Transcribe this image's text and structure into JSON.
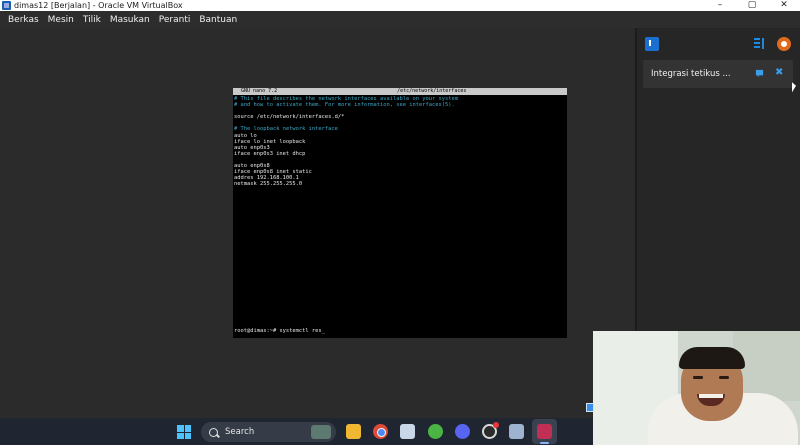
{
  "window": {
    "title": "dimas12 [Berjalan] - Oracle VM VirtualBox",
    "controls": [
      "–",
      "▢",
      "✕"
    ]
  },
  "menu": {
    "items": [
      "Berkas",
      "Mesin",
      "Tilik",
      "Masukan",
      "Peranti",
      "Bantuan"
    ]
  },
  "terminal": {
    "editor": "GNU nano 7.2",
    "file": "/etc/network/interfaces",
    "lines": [
      {
        "text": "# This file describes the network interfaces available on your system",
        "type": "comment"
      },
      {
        "text": "# and how to activate them. For more information, see interfaces(5).",
        "type": "comment"
      },
      {
        "text": "",
        "type": "plain"
      },
      {
        "text": "source /etc/network/interfaces.d/*",
        "type": "plain"
      },
      {
        "text": "",
        "type": "plain"
      },
      {
        "text": "# The loopback network interface",
        "type": "comment"
      },
      {
        "text": "auto lo",
        "type": "plain"
      },
      {
        "text": "iface lo inet loopback",
        "type": "plain"
      },
      {
        "text": "auto enp0s3",
        "type": "plain"
      },
      {
        "text": "iface enp0s3 inet dhcp",
        "type": "plain"
      },
      {
        "text": "",
        "type": "plain"
      },
      {
        "text": "auto enp0s8",
        "type": "plain"
      },
      {
        "text": "iface enp0s8 inet static",
        "type": "plain"
      },
      {
        "text": "addres 192.168.100.1",
        "type": "plain"
      },
      {
        "text": "netmask 255.255.255.0",
        "type": "plain"
      }
    ],
    "prompt": "root@dimas:~# systemctl res_"
  },
  "side_panel": {
    "notice_text": "Integrasi tetikus ...",
    "close_symbol": "✖"
  },
  "taskbar": {
    "search_label": "Search"
  },
  "colors": {
    "comment": "#3aa8c7",
    "accent": "#1b6fd0",
    "taskbar": "#1f2631"
  }
}
